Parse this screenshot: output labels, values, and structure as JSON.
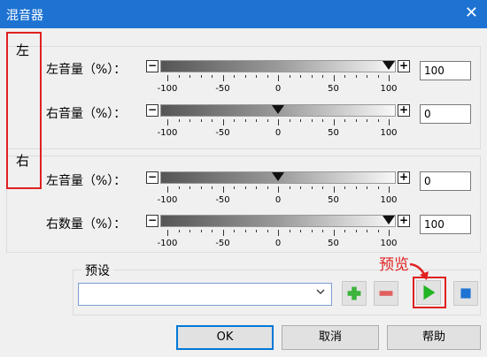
{
  "window": {
    "title": "混音器",
    "close_glyph": "✕"
  },
  "sections": [
    {
      "label": "左"
    },
    {
      "label": "右"
    }
  ],
  "rows": [
    {
      "label": "左音量（%）：",
      "value": "100",
      "level": 100
    },
    {
      "label": "右音量（%）：",
      "value": "0",
      "level": 0
    },
    {
      "label": "左音量（%）：",
      "value": "0",
      "level": 0
    },
    {
      "label": "右数量（%）：",
      "value": "100",
      "level": 100
    }
  ],
  "slider": {
    "minus": "−",
    "plus": "+",
    "range": [
      -100,
      100
    ],
    "tick_labels": [
      "-100",
      "-50",
      "0",
      "50",
      "100"
    ]
  },
  "preset": {
    "label": "预设",
    "value": ""
  },
  "preview": {
    "label": "预览"
  },
  "buttons": {
    "ok": "OK",
    "cancel": "取消",
    "help": "帮助"
  },
  "colors": {
    "accent": "#1e73d2",
    "highlight": "#e02020",
    "play": "#22b422",
    "stop": "#1e73d2",
    "add": "#3cb43c",
    "remove": "#e06060"
  },
  "icons": [
    "close-icon",
    "chevron-down-icon",
    "add-icon",
    "remove-icon",
    "play-icon",
    "stop-icon",
    "arrow-icon"
  ]
}
